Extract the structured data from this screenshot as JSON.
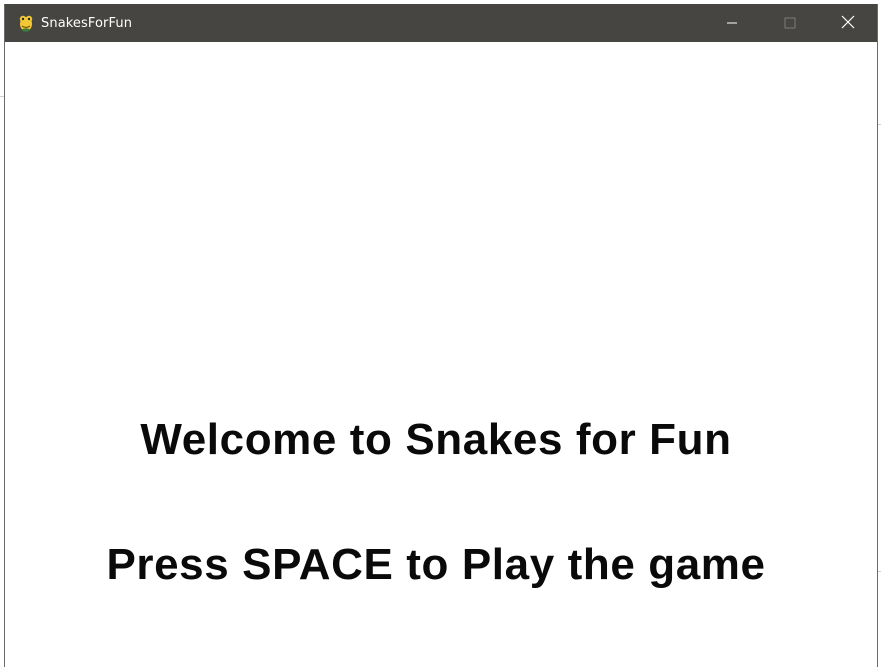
{
  "window": {
    "title": "SnakesForFun",
    "app_icon": "pygame-snake-icon",
    "titlebar_color": "#474542",
    "controls": {
      "minimize": "minimize-icon",
      "maximize": "maximize-icon",
      "close": "close-icon"
    }
  },
  "game": {
    "welcome_text": "Welcome to Snakes for Fun",
    "prompt_text": "Press SPACE to Play the game",
    "background_color": "#ffffff",
    "text_color": "#0a0a0a"
  }
}
